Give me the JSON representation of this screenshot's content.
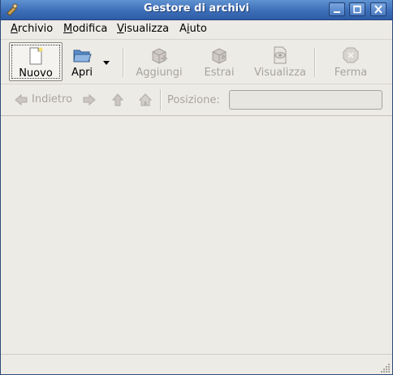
{
  "window": {
    "title": "Gestore di archivi",
    "title_bar_color": "#3d6eb8",
    "icons": {
      "app": "file-roller-icon",
      "minimize": "minimize-icon",
      "maximize": "maximize-icon",
      "close": "close-icon"
    }
  },
  "menubar": {
    "items": [
      {
        "mnemonic": "A",
        "rest": "rchivio"
      },
      {
        "mnemonic": "M",
        "rest": "odifica"
      },
      {
        "mnemonic": "V",
        "rest": "isualizza"
      },
      {
        "mnemonic": "",
        "pre": "A",
        "mn": "i",
        "post": "uto"
      }
    ]
  },
  "toolbar": {
    "new_label": "Nuovo",
    "open_label": "Apri",
    "add_label": "Aggiungi",
    "extract_label": "Estrai",
    "view_label": "Visualizza",
    "stop_label": "Ferma"
  },
  "location": {
    "back_label": "Indietro",
    "location_label": "Posizione:",
    "location_value": ""
  },
  "colors": {
    "window_bg": "#edebe6",
    "disabled_text": "#a8a49d"
  }
}
